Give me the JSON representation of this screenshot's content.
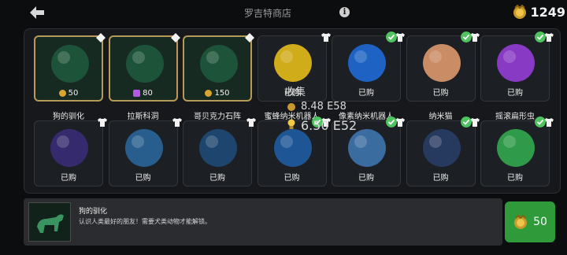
{
  "header": {
    "title": "罗吉特商店",
    "currency": "1249"
  },
  "overlay": {
    "collect": "收集",
    "rate": "8.48 E58",
    "total": "6.50 E52"
  },
  "items": [
    {
      "name": "狗的驯化",
      "price": "50",
      "status": "price",
      "currency": "gold",
      "thumb_color": "#1f5a3c"
    },
    {
      "name": "拉斯科洞",
      "price": "80",
      "status": "price",
      "currency": "purple",
      "thumb_color": "#1f5a3c"
    },
    {
      "name": "哥贝克力石阵",
      "price": "150",
      "status": "price",
      "currency": "gold",
      "thumb_color": "#1f5a3c"
    },
    {
      "name": "蜜蜂纳米机器人",
      "price": "已购",
      "status": "owned",
      "thumb_color": "#f0c419"
    },
    {
      "name": "像素纳米机器人",
      "price": "已购",
      "status": "owned",
      "thumb_color": "#1e6fe0"
    },
    {
      "name": "纳米猫",
      "price": "已购",
      "status": "owned",
      "thumb_color": "#e8a070"
    },
    {
      "name": "摇滚扁形虫",
      "price": "已购",
      "status": "owned",
      "thumb_color": "#9b3fe0"
    },
    {
      "name": "",
      "price": "已购",
      "status": "owned",
      "thumb_color": "#3a2d7a"
    },
    {
      "name": "",
      "price": "已购",
      "status": "owned",
      "thumb_color": "#2a6aa0"
    },
    {
      "name": "",
      "price": "已购",
      "status": "owned",
      "thumb_color": "#1d4c7a"
    },
    {
      "name": "",
      "price": "已购",
      "status": "owned",
      "thumb_color": "#1f5fa8"
    },
    {
      "name": "",
      "price": "已购",
      "status": "owned",
      "thumb_color": "#3f7ab5"
    },
    {
      "name": "",
      "price": "已购",
      "status": "owned",
      "thumb_color": "#28406a"
    },
    {
      "name": "",
      "price": "已购",
      "status": "owned",
      "thumb_color": "#33b050"
    }
  ],
  "detail": {
    "name": "狗的驯化",
    "description": "认识人类最好的朋友！需要犬类动物才能解锁。",
    "price": "50"
  },
  "colors": {
    "gold_border": "#b79a58",
    "buy_green": "#2f9a3a",
    "check_green": "#4fc35f"
  }
}
